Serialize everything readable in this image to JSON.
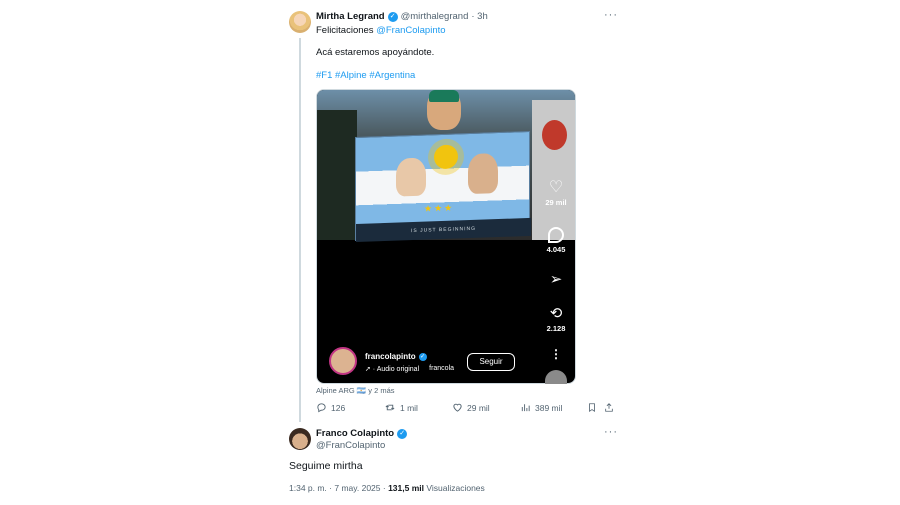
{
  "tweet1": {
    "author_name": "Mirtha Legrand",
    "handle": "@mirthalegrand",
    "time": "· 3h",
    "line1_prefix": "Felicitaciones ",
    "line1_mention": "@FranColapinto",
    "line2": "Acá estaremos apoyándote.",
    "hashtags": "#F1 #Alpine #Argentina",
    "tagged": "Alpine ARG 🇦🇷 y 2 más",
    "actions": {
      "replies": "126",
      "retweets": "1 mil",
      "likes": "29 mil",
      "views": "389 mil"
    }
  },
  "reel": {
    "banner_text": "IS JUST BEGINNING",
    "likes": "29 mil",
    "comments": "4.045",
    "reposts": "2.128",
    "username": "francolapinto",
    "audio": "Audio original",
    "audio_user": "francola",
    "follow_label": "Seguir"
  },
  "tweet2": {
    "author_name": "Franco Colapinto",
    "handle": "@FranColapinto",
    "body": "Seguime mirtha",
    "timestamp": "1:34 p. m. · 7 may. 2025 · ",
    "views_count": "131,5 mil",
    "views_label": " Visualizaciones"
  },
  "colors": {
    "accent": "#1d9bf0",
    "muted": "#536471",
    "text": "#0f1419"
  }
}
